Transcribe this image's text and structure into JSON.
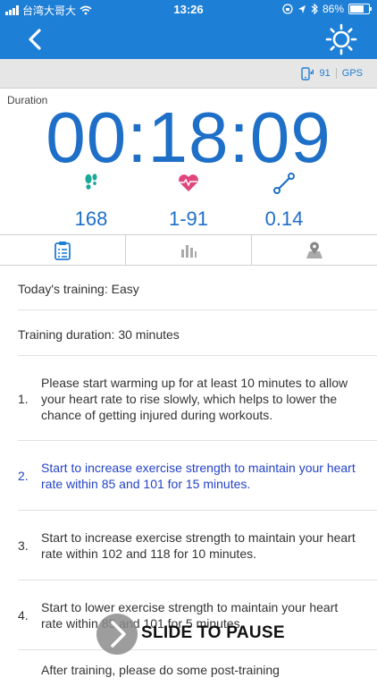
{
  "status_bar": {
    "carrier": "台湾大哥大",
    "time": "13:26",
    "battery": "86%",
    "battery_level": 0.86
  },
  "gps_bar": {
    "signal": "91",
    "gps": "GPS"
  },
  "duration": {
    "label": "Duration",
    "value": "00:18:09"
  },
  "metrics": {
    "steps": "168",
    "heart_zone": "1-91",
    "distance": "0.14"
  },
  "training": {
    "today": "Today's training: Easy",
    "duration": "Training duration: 30 minutes",
    "steps": [
      {
        "num": "1.",
        "text": "Please start warming up for at least 10 minutes to allow your heart rate to rise slowly, which helps to lower the chance of getting injured during workouts."
      },
      {
        "num": "2.",
        "text": "Start to increase exercise strength to maintain your heart rate within 85 and 101 for 15 minutes."
      },
      {
        "num": "3.",
        "text": "Start to increase exercise strength to maintain your heart rate within 102 and 118 for 10 minutes."
      },
      {
        "num": "4.",
        "text": "Start to lower exercise strength to maintain your heart rate within 85 and 101 for 5 minutes."
      },
      {
        "num": "",
        "text": "After training, please do some post-training"
      }
    ]
  },
  "slide": {
    "label": "SLIDE TO PAUSE"
  },
  "colors": {
    "primary": "#1e7fd6",
    "accent_text": "#1e6fc7",
    "steps_icon": "#1aa898",
    "heart_icon": "#e0457b",
    "active_step": "#2443c8"
  }
}
